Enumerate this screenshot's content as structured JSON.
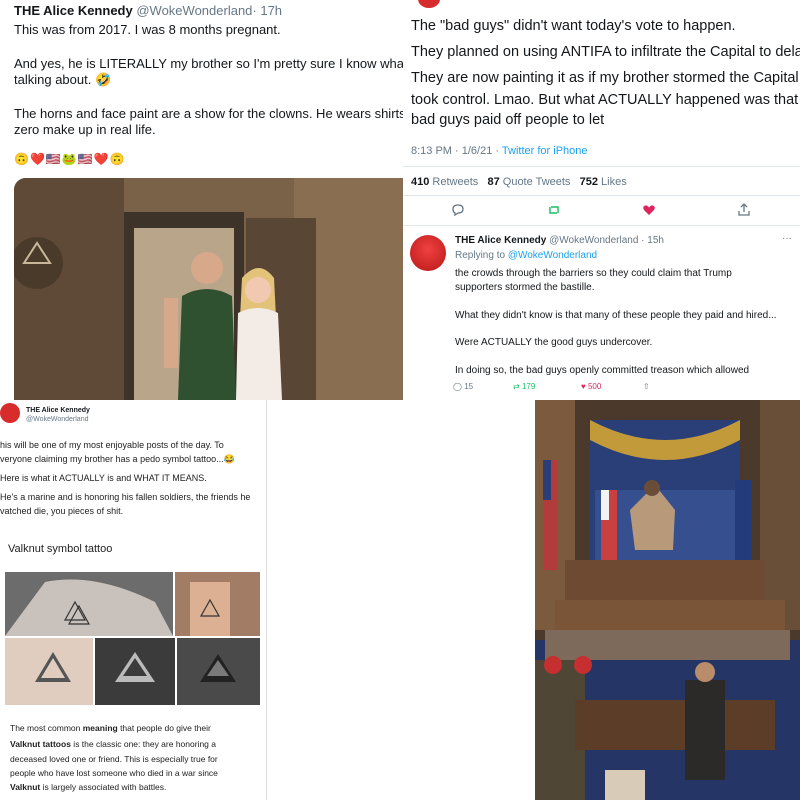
{
  "panel_a": {
    "name": "THE Alice Kennedy",
    "handle": "@WokeWonderland",
    "time": "· 17h",
    "lines": [
      "This was from 2017. I was 8 months pregnant.",
      "And yes, he is LITERALLY my brother so I'm pretty sure I know what I'r",
      "talking about. 🤣",
      "The horns and face paint are a show for the clowns. He wears shirts an",
      "zero make up in real life."
    ],
    "emojis": "🙃❤️🇺🇸🐸🇺🇸❤️🙃"
  },
  "panel_b": {
    "lines": [
      "The \"bad guys\" didn't want today's vote to happen.",
      "They planned on using ANTIFA to infiltrate the Capital to delay it.",
      "They are now painting it as if my brother stormed the Capital and",
      "took control. Lmao. But what ACTUALLY happened was that the",
      "bad guys paid off people to let"
    ],
    "meta_time": "8:13 PM · 1/6/21 · ",
    "meta_source": "Twitter for iPhone",
    "stats": [
      {
        "value": "410",
        "label": "Retweets"
      },
      {
        "value": "87",
        "label": "Quote Tweets"
      },
      {
        "value": "752",
        "label": "Likes"
      }
    ],
    "reply": {
      "name": "THE Alice Kennedy",
      "handle": "@WokeWonderland",
      "time": "· 15h",
      "replying_prefix": "Replying to ",
      "replying_to": "@WokeWonderland",
      "lines": [
        "the crowds through the barriers so they could claim that Trump",
        "supporters stormed the bastille.",
        "What they didn't know is that many of these people they paid and hired...",
        "Were ACTUALLY the good guys undercover.",
        "In doing so, the bad guys openly committed treason which allowed"
      ],
      "counts": {
        "replies": "15",
        "retweets": "179",
        "likes": "500"
      }
    }
  },
  "panel_c": {
    "name": "THE Alice Kennedy",
    "handle": "@WokeWonderland",
    "lines": [
      "his will be one of my most enjoyable posts of the day. To",
      "veryone claiming my brother has a pedo symbol tattoo...😂",
      "Here is what it ACTUALLY is and WHAT IT MEANS.",
      "He's a marine and is honoring his fallen soldiers, the friends he",
      "vatched die, you pieces of shit."
    ],
    "section_title": "Valknut symbol tattoo",
    "caption": {
      "l1_pre": "The most common ",
      "l1_bold": "meaning",
      "l1_post": " that people do give their",
      "l2_bold": "Valknut tattoos",
      "l2_post": " is the classic one: they are honoring a",
      "l3": "deceased loved one or friend. This is especially true for",
      "l4": "people who have lost someone who died in a war since",
      "l5_bold": "Valknut",
      "l5_post": " is largely associated with battles."
    }
  }
}
